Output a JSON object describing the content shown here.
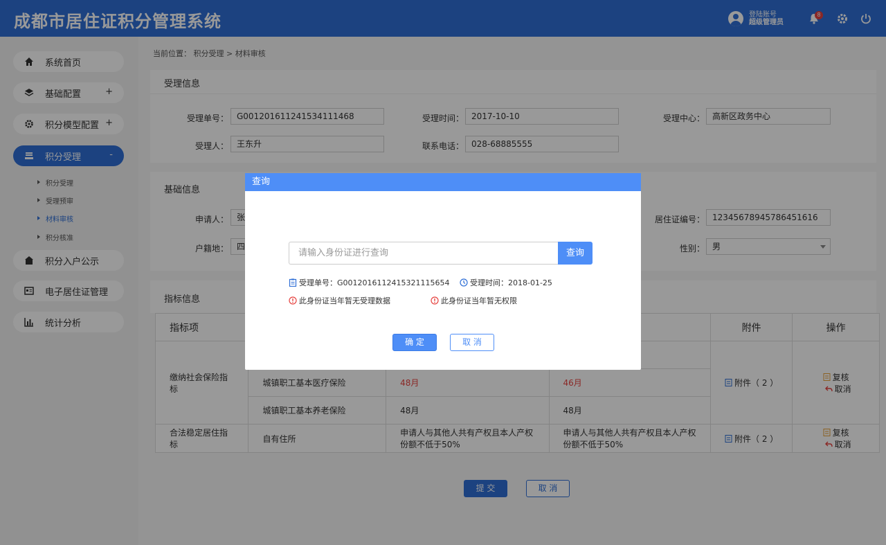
{
  "app": {
    "title": "成都市居住证积分管理系统",
    "user_line1": "登陆账号",
    "user_line2": "超级管理员",
    "notification_count": "8",
    "brand_color": "#2f6fd6"
  },
  "sidebar": {
    "items": [
      {
        "label": "系统首页",
        "icon": "home-icon"
      },
      {
        "label": "基础配置",
        "icon": "layers-icon",
        "toggle": "+"
      },
      {
        "label": "积分模型配置",
        "icon": "gear-icon",
        "toggle": "+"
      },
      {
        "label": "积分受理",
        "icon": "inbox-icon",
        "toggle": "-"
      },
      {
        "label": "积分入户公示",
        "icon": "house-icon"
      },
      {
        "label": "电子居住证管理",
        "icon": "idcard-icon"
      },
      {
        "label": "统计分析",
        "icon": "chart-icon"
      }
    ],
    "sub_items": [
      "积分受理",
      "受理预审",
      "材料审核",
      "积分核准"
    ]
  },
  "breadcrumb": "当前位置： 积分受理 > 材料审核",
  "accept_info": {
    "title": "受理信息",
    "no_label": "受理单号：",
    "no_value": "G001201611241534111468",
    "time_label": "受理时间：",
    "time_value": "2017-10-10",
    "center_label": "受理中心：",
    "center_value": "高新区政务中心",
    "person_label": "受理人：",
    "person_value": "王东升",
    "phone_label": "联系电话：",
    "phone_value": "028-68885555"
  },
  "basic_info": {
    "title": "基础信息",
    "applicant_label": "申请人：",
    "applicant_value": "张",
    "permit_label": "居住证编号：",
    "permit_value": "12345678945786451616",
    "huji_label": "户籍地：",
    "huji_value": "四",
    "gender_label": "性别：",
    "gender_value": "男"
  },
  "indicator": {
    "title": "指标信息",
    "headers": [
      "指标项",
      "附件",
      "操作"
    ],
    "rows": [
      {
        "item": "缴纳社会保险指标",
        "sub": "城镇职工基本医疗保险",
        "v1": "48月",
        "v2": "46月"
      },
      {
        "sub": "城镇职工基本养老保险",
        "v1": "48月",
        "v2": "48月"
      },
      {
        "item": "合法稳定居住指标",
        "sub": "自有住所",
        "v1": "申请人与其他人共有产权且本人产权份额不低于50%",
        "v2": "申请人与其他人共有产权且本人产权份额不低于50%"
      }
    ],
    "attach_label": "附件（ 2 ）",
    "review_label": "复核",
    "cancel_label": "取消"
  },
  "footer": {
    "submit": "提 交",
    "cancel": "取 消"
  },
  "modal": {
    "title": "查询",
    "search_placeholder": "请输入身份证进行查询",
    "search_button": "查询",
    "order_no": "受理单号：G0012016112415321115654",
    "accept_time": "受理时间：2018-01-25",
    "warn1": "此身份证当年暂无受理数据",
    "warn2": "此身份证当年暂无权限",
    "ok": "确 定",
    "cancel": "取 消"
  }
}
